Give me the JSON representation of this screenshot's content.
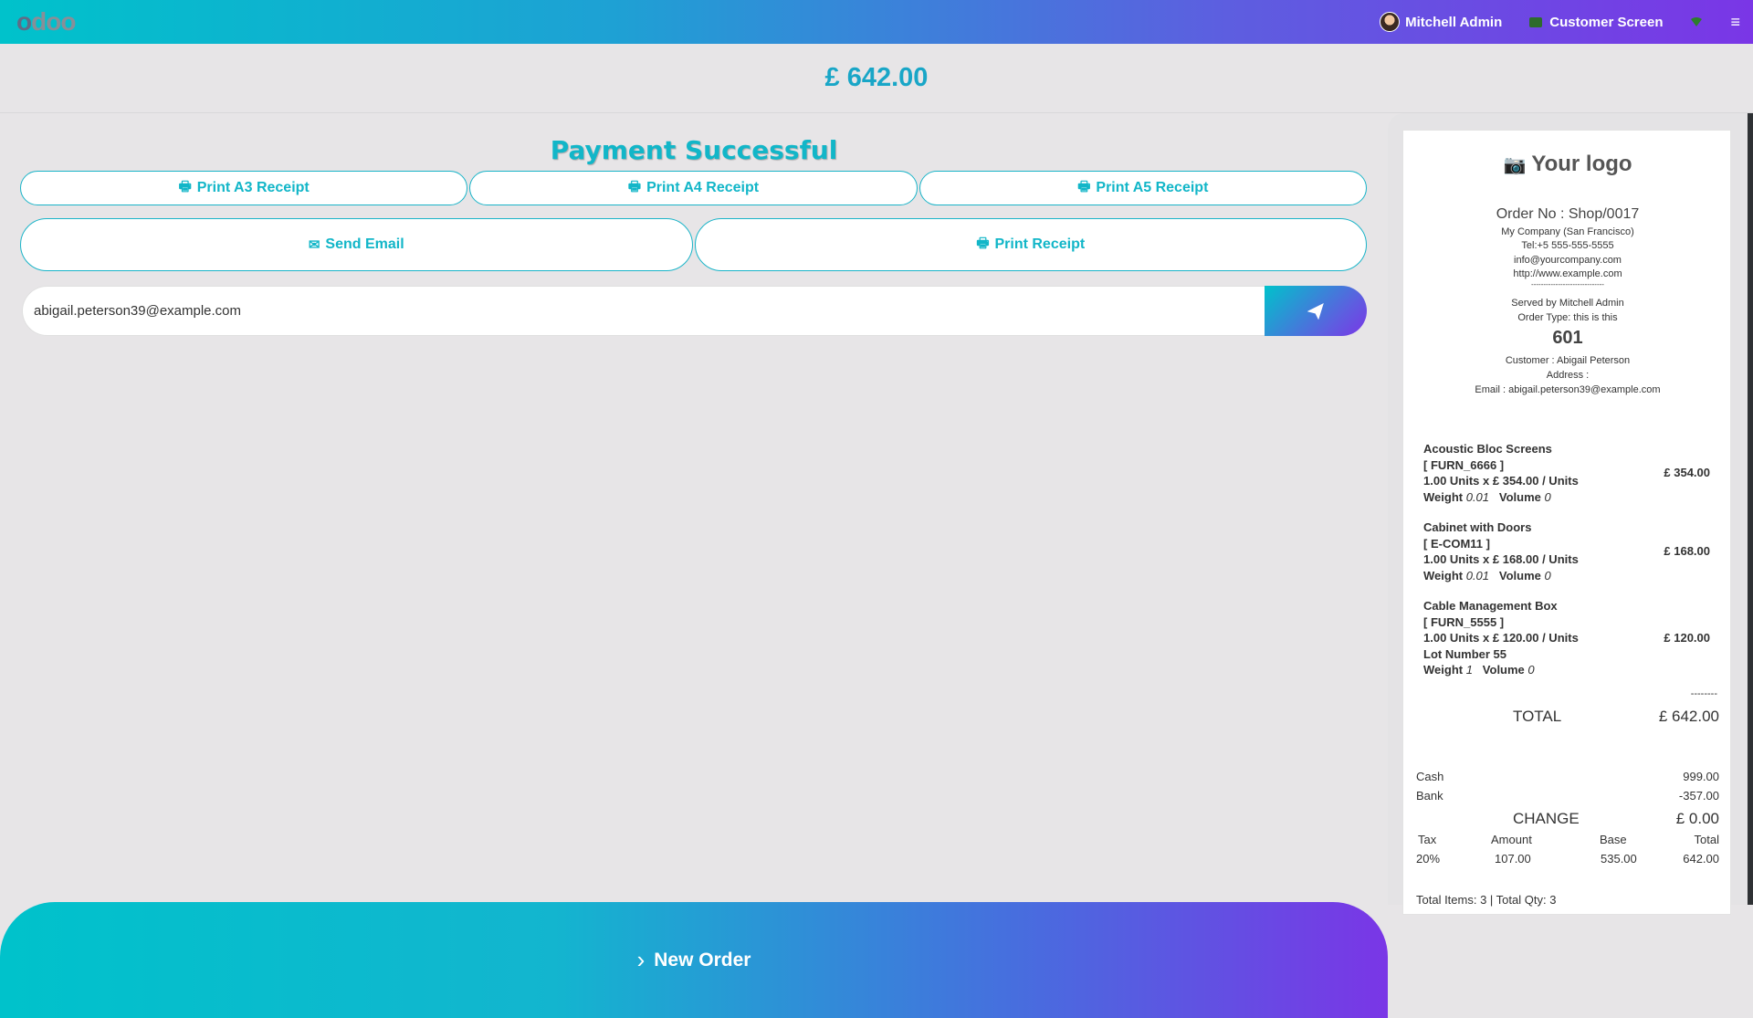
{
  "topbar": {
    "logo_part1": "o",
    "logo_part2": "doo",
    "user_name": "Mitchell Admin",
    "customer_screen": "Customer Screen"
  },
  "amount": {
    "total_due": "£ 642.00"
  },
  "payment": {
    "title": "Payment Successful",
    "print_a3": "Print A3 Receipt",
    "print_a4": "Print A4 Receipt",
    "print_a5": "Print A5 Receipt",
    "send_email": "Send Email",
    "print_receipt": "Print Receipt",
    "email_value": "abigail.peterson39@example.com",
    "new_order": "New Order"
  },
  "receipt": {
    "logo_text": "Your logo",
    "order_no": "Order No : Shop/0017",
    "company": "My Company (San Francisco)",
    "tel": "Tel:+5 555-555-5555",
    "email": "info@yourcompany.com",
    "website": "http://www.example.com",
    "separator": "------------------------------",
    "served_by": "Served by Mitchell Admin",
    "order_type": "Order Type: this is this",
    "order_number": "601",
    "customer": "Customer : Abigail Peterson",
    "address": "Address :",
    "customer_email": "Email : abigail.peterson39@example.com",
    "lines": [
      {
        "name": "Acoustic Bloc Screens",
        "code": "[ FURN_6666 ]",
        "qty": "1.00  Units x £ 354.00 / Units",
        "lot": "",
        "weight_label": "Weight",
        "weight": "0.01",
        "volume_label": "Volume",
        "volume": "0",
        "price": "£ 354.00"
      },
      {
        "name": "Cabinet with Doors",
        "code": "[ E-COM11 ]",
        "qty": "1.00  Units x £ 168.00 / Units",
        "lot": "",
        "weight_label": "Weight",
        "weight": "0.01",
        "volume_label": "Volume",
        "volume": "0",
        "price": "£ 168.00"
      },
      {
        "name": "Cable Management Box",
        "code": "[ FURN_5555 ]",
        "qty": "1.00  Units x £ 120.00 / Units",
        "lot": "Lot Number 55",
        "weight_label": "Weight",
        "weight": "1",
        "volume_label": "Volume",
        "volume": "0",
        "price": "£ 120.00"
      }
    ],
    "dashes": "--------",
    "total_label": "TOTAL",
    "total_value": "£ 642.00",
    "payments": [
      {
        "method": "Cash",
        "amount": "999.00"
      },
      {
        "method": "Bank",
        "amount": "-357.00"
      }
    ],
    "change_label": "CHANGE",
    "change_value": "£ 0.00",
    "tax_headers": [
      "Tax",
      "Amount",
      "Base",
      "Total"
    ],
    "tax_row": [
      "20%",
      "107.00",
      "535.00",
      "642.00"
    ],
    "footer": "Total Items: 3 | Total Qty: 3"
  }
}
